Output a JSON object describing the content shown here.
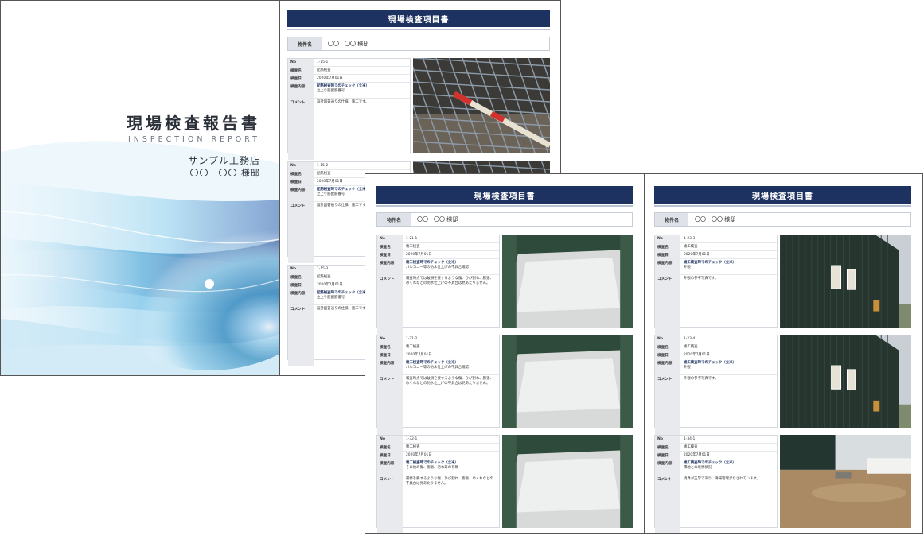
{
  "cover": {
    "title": "現場検査報告書",
    "subtitle": "INSPECTION REPORT",
    "company": "サンプル工務店",
    "owner": "〇〇　〇〇 様邸"
  },
  "report": {
    "page_title": "現場検査項目書",
    "property_label": "物件名",
    "property_value": "〇〇　〇〇 様邸",
    "labels": {
      "no": "No",
      "name": "検査名",
      "date": "検査日",
      "content": "検査内容",
      "comment": "コメント"
    }
  },
  "pages": [
    {
      "entries": [
        {
          "no": "1-15-1",
          "name": "配筋検査",
          "date": "2020年7月01日",
          "content_title": "配筋検査時でのチェック（立米）",
          "content_detail": "立上り筋配筋番号",
          "comment": "設計図書通りの仕様。施工です。"
        },
        {
          "no": "1-15-2",
          "name": "配筋検査",
          "date": "2020年7月01日",
          "content_title": "配筋検査時でのチェック（立米）",
          "content_detail": "立上り筋配筋番号",
          "comment": "設計図書通りの仕様。施工です。"
        },
        {
          "no": "1-15-3",
          "name": "配筋検査",
          "date": "2020年7月01日",
          "content_title": "配筋検査時でのチェック（立米）",
          "content_detail": "立上り筋配筋番号",
          "comment": "設計図書通りの仕様。施工です。"
        }
      ]
    },
    {
      "entries": [
        {
          "no": "1-21-1",
          "name": "竣工検査",
          "date": "2020年7月01日",
          "content_title": "竣工検査時でのチェック（立米）",
          "content_detail": "バルコニー等の防水仕上げの不具合確認",
          "comment": "検査時点では破損を要するような傷、ひび割れ、膨張、めくれなどの防水仕上げの不具合は見あたりません。"
        },
        {
          "no": "1-21-2",
          "name": "竣工検査",
          "date": "2020年7月01日",
          "content_title": "竣工検査時でのチェック（立米）",
          "content_detail": "バルコニー等の防水仕上げの不具合確認",
          "comment": "検査時点では破損を要するような傷、ひび割れ、膨張、めくれなどの防水仕上げの不具合は見あたりません。"
        },
        {
          "no": "1-32-1",
          "name": "竣工検査",
          "date": "2020年7月01日",
          "content_title": "竣工検査時でのチェック（立米）",
          "content_detail": "その他の傷、膨張、汚れ等の有無",
          "comment": "補修を要するような傷、ひび割れ、膨張、めくれなどの不具合は見あたりません。"
        }
      ]
    },
    {
      "entries": [
        {
          "no": "1-23-3",
          "name": "竣工検査",
          "date": "2020年7月01日",
          "content_title": "竣工検査時でのチェック（立米）",
          "content_detail": "外観",
          "comment": "外観の参考写真です。"
        },
        {
          "no": "1-23-4",
          "name": "竣工検査",
          "date": "2020年7月01日",
          "content_title": "竣工検査時でのチェック（立米）",
          "content_detail": "外観",
          "comment": "外観の参考写真です。"
        },
        {
          "no": "1-34-1",
          "name": "竣工検査",
          "date": "2020年7月01日",
          "content_title": "竣工検査時でのチェック（立米）",
          "content_detail": "隣地との境界状況",
          "comment": "境界が正常であり、清掃管理がなされています。"
        }
      ]
    }
  ],
  "colors": {
    "header_navy": "#1d3261",
    "label_gray": "#e8eaee",
    "accent_text": "#1d3261"
  },
  "photos": [
    "rebar-photo",
    "rebar-photo",
    "rebar-photo",
    "balcony-photo",
    "balcony-photo",
    "balcony-photo",
    "house-exterior-photo",
    "house-exterior-photo",
    "yard-photo"
  ]
}
